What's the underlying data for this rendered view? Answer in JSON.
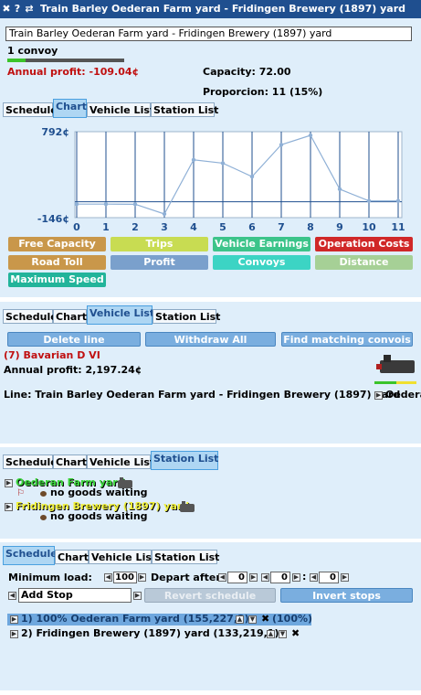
{
  "window": {
    "close_glyph": "✖",
    "help_glyph": "?",
    "pin_glyph": "⇄",
    "title": "Train Barley Oederan Farm yard - Fridingen Brewery (1897) yard"
  },
  "line_name": "Train Barley Oederan Farm yard - Fridingen Brewery (1897) yard",
  "convoy_count": "1 convoy",
  "annual_profit": "Annual profit: -109.04¢",
  "capacity": "Capacity: 72.00",
  "proporcion": "Proporcion: 11 (15%)",
  "tabs": [
    "Schedule",
    "Chart",
    "Vehicle List",
    "Station List"
  ],
  "colors": {
    "titlebar": "#1f4f8f",
    "active_tab": "#aed6f3",
    "profit_negative": "#c01010",
    "green_bar": "#3bc42a"
  },
  "chart_data": {
    "type": "line",
    "x": [
      0,
      1,
      2,
      3,
      4,
      5,
      6,
      7,
      8,
      9,
      10,
      11
    ],
    "values": [
      -28,
      -28,
      -30,
      -146,
      500,
      460,
      300,
      680,
      792,
      150,
      10,
      10
    ],
    "ylim": [
      -146,
      792
    ],
    "y_tick_labels": [
      "792¢",
      "-146¢"
    ],
    "x_tick_labels": [
      "0",
      "1",
      "2",
      "3",
      "4",
      "5",
      "6",
      "7",
      "8",
      "9",
      "10",
      "11"
    ],
    "line_color": "#8fb0d6",
    "grid": true
  },
  "legend_buttons": [
    {
      "label": "Free Capacity",
      "color": "#c9974a"
    },
    {
      "label": "Trips",
      "color": "#c8dc52"
    },
    {
      "label": "Vehicle Earnings",
      "color": "#3cc48a"
    },
    {
      "label": "Operation Costs",
      "color": "#d02828"
    },
    {
      "label": "Road Toll",
      "color": "#c9974a"
    },
    {
      "label": "Profit",
      "color": "#7aa0cc"
    },
    {
      "label": "Convoys",
      "color": "#3cd4c4"
    },
    {
      "label": "Distance",
      "color": "#a6d096"
    },
    {
      "label": "Maximum Speed",
      "color": "#22b49a"
    }
  ],
  "vehicle_list": {
    "delete_line": "Delete line",
    "withdraw_all": "Withdraw All",
    "find_matching": "Find matching convois",
    "vehicle_name": "(7) Bavarian D VI",
    "vehicle_profit": "Annual profit: 2,197.24¢",
    "vehicle_line": "Line: Train Barley Oederan Farm yard - Fridingen Brewery (1897) yard",
    "vehicle_line_tail": "Oedera"
  },
  "station_list": {
    "stations": [
      {
        "name": "Oederan Farm yard",
        "color": "#3bd43b",
        "waiting": "no goods waiting"
      },
      {
        "name": "Fridingen Brewery (1897) yard",
        "color": "#f0f038",
        "waiting": "no goods waiting"
      }
    ]
  },
  "schedule": {
    "min_load_label": "Minimum load:",
    "min_load_value": "100",
    "depart_after_label": "Depart after",
    "depart_values": [
      "0",
      "0",
      "0"
    ],
    "add_stop": "Add Stop",
    "revert": "Revert schedule",
    "invert": "Invert stops",
    "stops": [
      "1) 100% Oederan Farm yard (155,227,3)",
      "2) Fridingen Brewery (1897) yard (133,219,1)"
    ],
    "stop1_pct": "(100%)"
  }
}
